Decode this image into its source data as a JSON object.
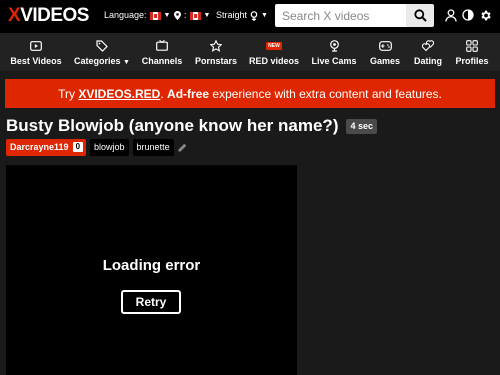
{
  "header": {
    "logo_x": "X",
    "logo_rest": "VIDEOS",
    "language_label": "Language:",
    "location_label": ":",
    "orientation_label": "Straight",
    "search_placeholder": "Search X videos",
    "icons": [
      "user-icon",
      "contrast-icon",
      "gear-icon"
    ]
  },
  "nav": {
    "items": [
      {
        "label": "Best Videos",
        "icon": "video-icon"
      },
      {
        "label": "Categories",
        "icon": "tags-icon"
      },
      {
        "label": "Channels",
        "icon": "channel-icon"
      },
      {
        "label": "Pornstars",
        "icon": "star-icon"
      },
      {
        "label": "RED videos",
        "icon": "red-icon",
        "badge": "NEW"
      },
      {
        "label": "Live Cams",
        "icon": "webcam-icon"
      },
      {
        "label": "Games",
        "icon": "gamepad-icon"
      },
      {
        "label": "Dating",
        "icon": "dating-icon"
      },
      {
        "label": "Profiles",
        "icon": "profiles-icon"
      }
    ]
  },
  "promo": {
    "prefix": "Try ",
    "link": "XVIDEOS.RED",
    "dot": ". ",
    "bold": "Ad-free",
    "suffix": " experience with extra content and features."
  },
  "video": {
    "title": "Busty Blowjob (anyone know her name?)",
    "duration": "4 sec",
    "uploader": "Darcrayne119",
    "uploader_count": "0",
    "tags": [
      "blowjob",
      "brunette"
    ]
  },
  "player": {
    "error": "Loading error",
    "retry_label": "Retry"
  },
  "colors": {
    "brand_red": "#de2600",
    "nav_bg": "#222222",
    "page_bg": "#1a1a1a"
  }
}
